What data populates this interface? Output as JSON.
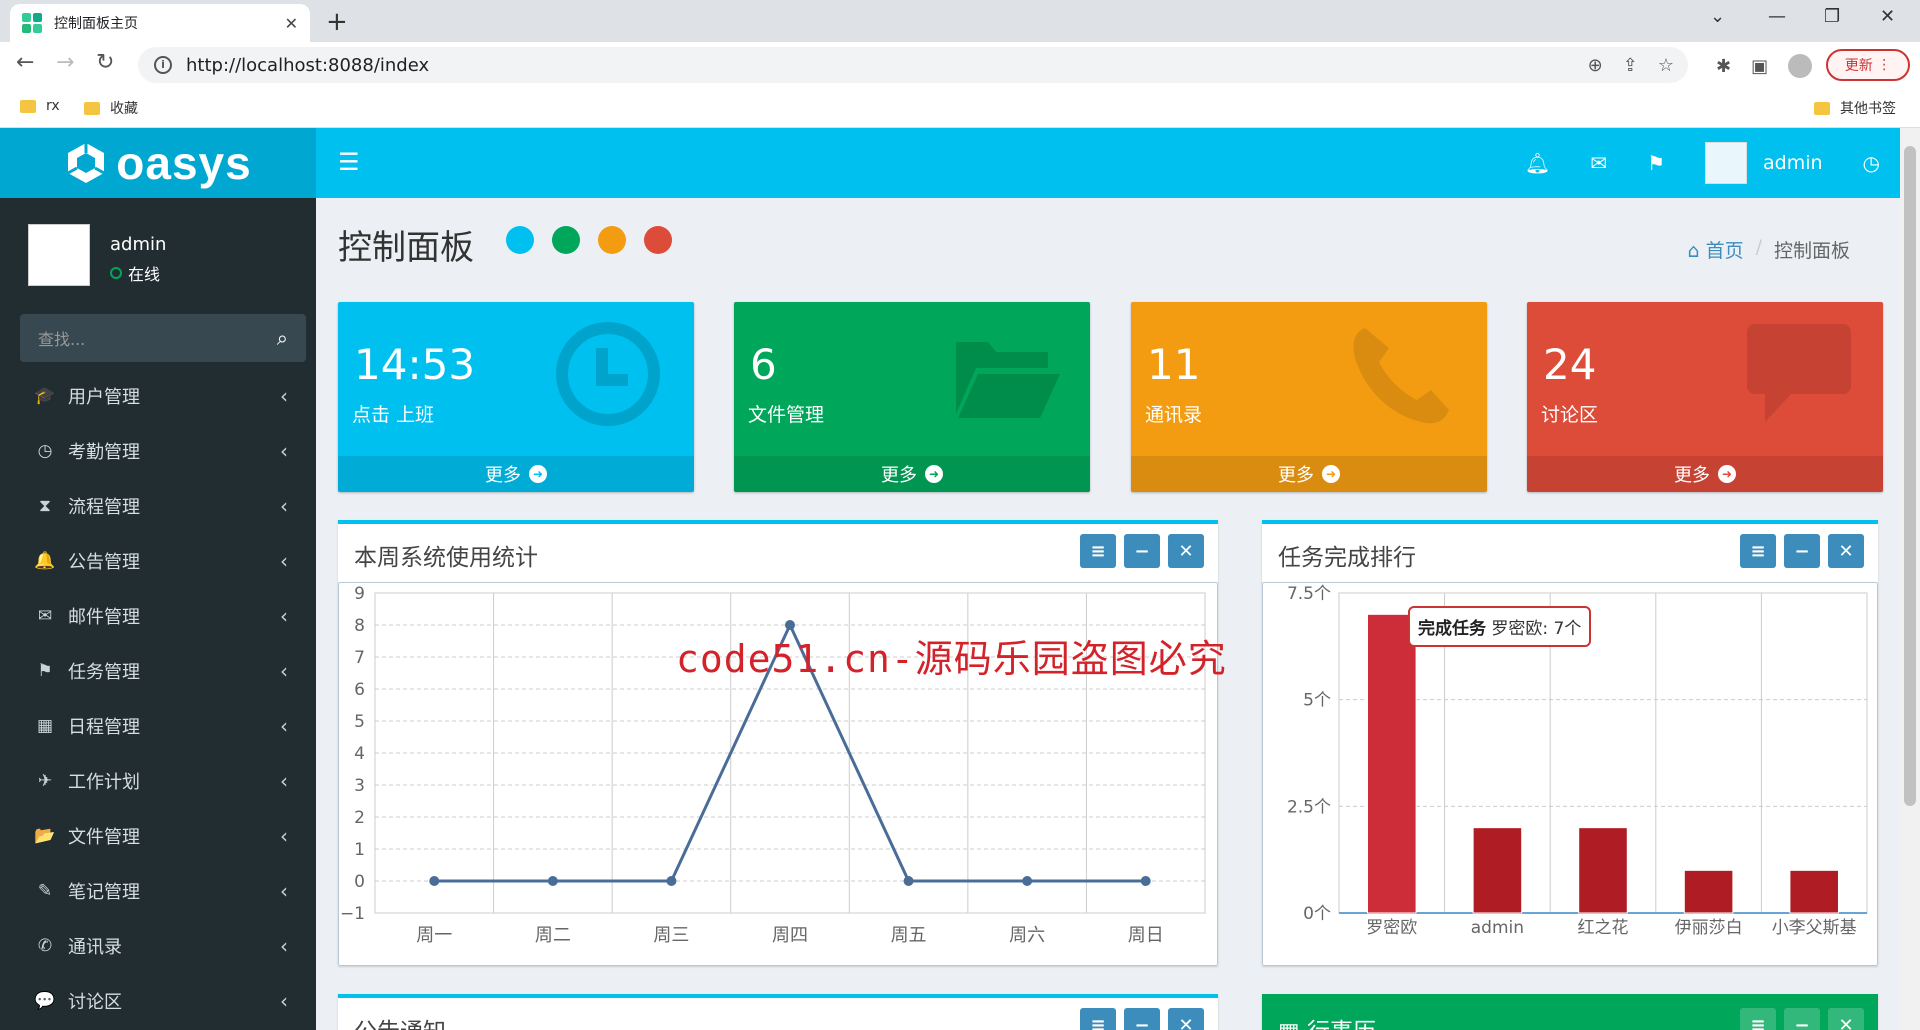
{
  "browser": {
    "tab_title": "控制面板主页",
    "url": "http://localhost:8088/index",
    "update_label": "更新",
    "bookmarks": [
      "rx",
      "收藏"
    ],
    "other_bookmarks": "其他书签"
  },
  "app": {
    "brand": "oasys",
    "user": "admin",
    "status": "在线",
    "search_placeholder": "查找...",
    "menu": [
      {
        "label": "用户管理",
        "icon": "graduation-cap-icon",
        "glyph": "🎓"
      },
      {
        "label": "考勤管理",
        "icon": "clock-icon",
        "glyph": "◷"
      },
      {
        "label": "流程管理",
        "icon": "hourglass-icon",
        "glyph": "⧗"
      },
      {
        "label": "公告管理",
        "icon": "bell-icon",
        "glyph": "🔔"
      },
      {
        "label": "邮件管理",
        "icon": "envelope-icon",
        "glyph": "✉"
      },
      {
        "label": "任务管理",
        "icon": "flag-icon",
        "glyph": "⚑"
      },
      {
        "label": "日程管理",
        "icon": "calendar-icon",
        "glyph": "▦"
      },
      {
        "label": "工作计划",
        "icon": "plane-icon",
        "glyph": "✈"
      },
      {
        "label": "文件管理",
        "icon": "folder-open-icon",
        "glyph": "📂"
      },
      {
        "label": "笔记管理",
        "icon": "edit-icon",
        "glyph": "✎"
      },
      {
        "label": "通讯录",
        "icon": "phone-icon",
        "glyph": "✆"
      },
      {
        "label": "讨论区",
        "icon": "comment-icon",
        "glyph": "💬"
      }
    ]
  },
  "page": {
    "title": "控制面板",
    "breadcrumb_home": "首页",
    "breadcrumb_current": "控制面板",
    "color_dots": [
      "#00c0ef",
      "#00a65a",
      "#f39c12",
      "#dd4b39"
    ]
  },
  "cards": [
    {
      "value": "14:53",
      "label": "点击 上班",
      "more": "更多",
      "color": "#00c0ef",
      "icon": "clock-icon"
    },
    {
      "value": "6",
      "label": "文件管理",
      "more": "更多",
      "color": "#00a65a",
      "icon": "folder-open-icon"
    },
    {
      "value": "11",
      "label": "通讯录",
      "more": "更多",
      "color": "#f39c12",
      "icon": "phone-icon"
    },
    {
      "value": "24",
      "label": "讨论区",
      "more": "更多",
      "color": "#dd4b39",
      "icon": "comment-icon"
    }
  ],
  "watermark": "code51.cn-源码乐园盗图必究",
  "panels": {
    "weekly_title": "本周系统使用统计",
    "ranking_title": "任务完成排行",
    "notice_title": "公告通知",
    "calendar_title": "行事历"
  },
  "tooltip": {
    "series": "完成任务",
    "text": "罗密欧: 7个"
  },
  "chart_data": [
    {
      "type": "line",
      "title": "本周系统使用统计",
      "categories": [
        "周一",
        "周二",
        "周三",
        "周四",
        "周五",
        "周六",
        "周日"
      ],
      "values": [
        0,
        0,
        0,
        8,
        0,
        0,
        0
      ],
      "ylim": [
        -1,
        9
      ],
      "yticks": [
        -1,
        0,
        1,
        2,
        3,
        4,
        5,
        6,
        7,
        8,
        9
      ],
      "grid": true,
      "color": "#4a6d98"
    },
    {
      "type": "bar",
      "title": "任务完成排行",
      "categories": [
        "罗密欧",
        "admin",
        "红之花",
        "伊丽莎白",
        "小李父斯基"
      ],
      "values": [
        7,
        2,
        2,
        1,
        1
      ],
      "ylim": [
        0,
        7.5
      ],
      "yticks": [
        "0个",
        "2.5个",
        "5个",
        "7.5个"
      ],
      "grid": true,
      "color": "#b01c24",
      "highlight_color": "#cc2d38"
    }
  ]
}
